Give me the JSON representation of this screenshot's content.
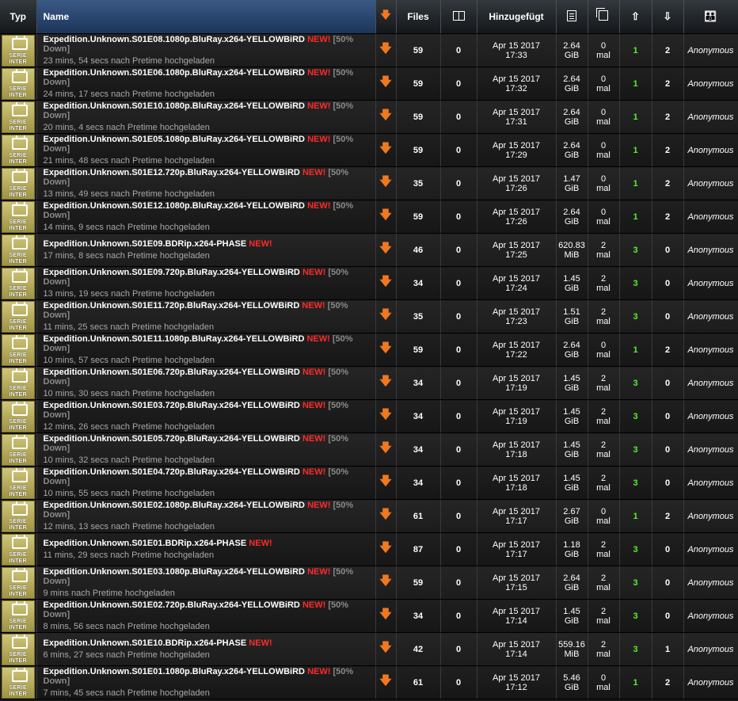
{
  "headers": {
    "typ": "Typ",
    "name": "Name",
    "files": "Files",
    "added": "Hinzugefügt",
    "icons": {
      "download": "download-arrow-icon",
      "description": "book-icon",
      "size": "document-icon",
      "snatched": "copy-icon",
      "seeders": "up-arrow-icon",
      "leechers": "down-arrow-icon",
      "uploader": "people-icon"
    }
  },
  "category_label": [
    "SERIE",
    "INTER"
  ],
  "colors": {
    "new": "#ff2a2a",
    "download": "#f07820",
    "seeders": "#55ee33",
    "header_name": "#2a4770"
  },
  "rows": [
    {
      "name": "Expedition.Unknown.S01E08.1080p.BluRay.x264-YELLOWBiRD",
      "new": "NEW!",
      "promo": "[50% Down]",
      "sub": "23 mins, 54 secs nach Pretime hochgeladen",
      "files": "59",
      "comments": "0",
      "date": "Apr 15 2017",
      "time": "17:33",
      "size": "2.64",
      "unit": "GiB",
      "snatched": "0",
      "snatched_unit": "mal",
      "seeders": "1",
      "leechers": "2",
      "uploader": "Anonymous"
    },
    {
      "name": "Expedition.Unknown.S01E06.1080p.BluRay.x264-YELLOWBiRD",
      "new": "NEW!",
      "promo": "[50% Down]",
      "sub": "24 mins, 17 secs nach Pretime hochgeladen",
      "files": "59",
      "comments": "0",
      "date": "Apr 15 2017",
      "time": "17:32",
      "size": "2.64",
      "unit": "GiB",
      "snatched": "0",
      "snatched_unit": "mal",
      "seeders": "1",
      "leechers": "2",
      "uploader": "Anonymous"
    },
    {
      "name": "Expedition.Unknown.S01E10.1080p.BluRay.x264-YELLOWBiRD",
      "new": "NEW!",
      "promo": "[50% Down]",
      "sub": "20 mins, 4 secs nach Pretime hochgeladen",
      "files": "59",
      "comments": "0",
      "date": "Apr 15 2017",
      "time": "17:31",
      "size": "2.64",
      "unit": "GiB",
      "snatched": "0",
      "snatched_unit": "mal",
      "seeders": "1",
      "leechers": "2",
      "uploader": "Anonymous"
    },
    {
      "name": "Expedition.Unknown.S01E05.1080p.BluRay.x264-YELLOWBiRD",
      "new": "NEW!",
      "promo": "[50% Down]",
      "sub": "21 mins, 48 secs nach Pretime hochgeladen",
      "files": "59",
      "comments": "0",
      "date": "Apr 15 2017",
      "time": "17:29",
      "size": "2.64",
      "unit": "GiB",
      "snatched": "0",
      "snatched_unit": "mal",
      "seeders": "1",
      "leechers": "2",
      "uploader": "Anonymous"
    },
    {
      "name": "Expedition.Unknown.S01E12.720p.BluRay.x264-YELLOWBiRD",
      "new": "NEW!",
      "promo": "[50% Down]",
      "sub": "13 mins, 49 secs nach Pretime hochgeladen",
      "files": "35",
      "comments": "0",
      "date": "Apr 15 2017",
      "time": "17:26",
      "size": "1.47",
      "unit": "GiB",
      "snatched": "0",
      "snatched_unit": "mal",
      "seeders": "1",
      "leechers": "2",
      "uploader": "Anonymous"
    },
    {
      "name": "Expedition.Unknown.S01E12.1080p.BluRay.x264-YELLOWBiRD",
      "new": "NEW!",
      "promo": "[50% Down]",
      "sub": "14 mins, 9 secs nach Pretime hochgeladen",
      "files": "59",
      "comments": "0",
      "date": "Apr 15 2017",
      "time": "17:26",
      "size": "2.64",
      "unit": "GiB",
      "snatched": "0",
      "snatched_unit": "mal",
      "seeders": "1",
      "leechers": "2",
      "uploader": "Anonymous"
    },
    {
      "name": "Expedition.Unknown.S01E09.BDRip.x264-PHASE",
      "new": "NEW!",
      "promo": "",
      "sub": "17 mins, 8 secs nach Pretime hochgeladen",
      "files": "46",
      "comments": "0",
      "date": "Apr 15 2017",
      "time": "17:25",
      "size": "620.83",
      "unit": "MiB",
      "snatched": "2",
      "snatched_unit": "mal",
      "seeders": "3",
      "leechers": "0",
      "uploader": "Anonymous"
    },
    {
      "name": "Expedition.Unknown.S01E09.720p.BluRay.x264-YELLOWBiRD",
      "new": "NEW!",
      "promo": "[50% Down]",
      "sub": "13 mins, 19 secs nach Pretime hochgeladen",
      "files": "34",
      "comments": "0",
      "date": "Apr 15 2017",
      "time": "17:24",
      "size": "1.45",
      "unit": "GiB",
      "snatched": "2",
      "snatched_unit": "mal",
      "seeders": "3",
      "leechers": "0",
      "uploader": "Anonymous"
    },
    {
      "name": "Expedition.Unknown.S01E11.720p.BluRay.x264-YELLOWBiRD",
      "new": "NEW!",
      "promo": "[50% Down]",
      "sub": "11 mins, 25 secs nach Pretime hochgeladen",
      "files": "35",
      "comments": "0",
      "date": "Apr 15 2017",
      "time": "17:23",
      "size": "1.51",
      "unit": "GiB",
      "snatched": "2",
      "snatched_unit": "mal",
      "seeders": "3",
      "leechers": "0",
      "uploader": "Anonymous"
    },
    {
      "name": "Expedition.Unknown.S01E11.1080p.BluRay.x264-YELLOWBiRD",
      "new": "NEW!",
      "promo": "[50% Down]",
      "sub": "10 mins, 57 secs nach Pretime hochgeladen",
      "files": "59",
      "comments": "0",
      "date": "Apr 15 2017",
      "time": "17:22",
      "size": "2.64",
      "unit": "GiB",
      "snatched": "0",
      "snatched_unit": "mal",
      "seeders": "1",
      "leechers": "2",
      "uploader": "Anonymous"
    },
    {
      "name": "Expedition.Unknown.S01E06.720p.BluRay.x264-YELLOWBiRD",
      "new": "NEW!",
      "promo": "[50% Down]",
      "sub": "10 mins, 30 secs nach Pretime hochgeladen",
      "files": "34",
      "comments": "0",
      "date": "Apr 15 2017",
      "time": "17:19",
      "size": "1.45",
      "unit": "GiB",
      "snatched": "2",
      "snatched_unit": "mal",
      "seeders": "3",
      "leechers": "0",
      "uploader": "Anonymous"
    },
    {
      "name": "Expedition.Unknown.S01E03.720p.BluRay.x264-YELLOWBiRD",
      "new": "NEW!",
      "promo": "[50% Down]",
      "sub": "12 mins, 26 secs nach Pretime hochgeladen",
      "files": "34",
      "comments": "0",
      "date": "Apr 15 2017",
      "time": "17:19",
      "size": "1.45",
      "unit": "GiB",
      "snatched": "2",
      "snatched_unit": "mal",
      "seeders": "3",
      "leechers": "0",
      "uploader": "Anonymous"
    },
    {
      "name": "Expedition.Unknown.S01E05.720p.BluRay.x264-YELLOWBiRD",
      "new": "NEW!",
      "promo": "[50% Down]",
      "sub": "10 mins, 32 secs nach Pretime hochgeladen",
      "files": "34",
      "comments": "0",
      "date": "Apr 15 2017",
      "time": "17:18",
      "size": "1.45",
      "unit": "GiB",
      "snatched": "2",
      "snatched_unit": "mal",
      "seeders": "3",
      "leechers": "0",
      "uploader": "Anonymous"
    },
    {
      "name": "Expedition.Unknown.S01E04.720p.BluRay.x264-YELLOWBiRD",
      "new": "NEW!",
      "promo": "[50% Down]",
      "sub": "10 mins, 55 secs nach Pretime hochgeladen",
      "files": "34",
      "comments": "0",
      "date": "Apr 15 2017",
      "time": "17:18",
      "size": "1.45",
      "unit": "GiB",
      "snatched": "2",
      "snatched_unit": "mal",
      "seeders": "3",
      "leechers": "0",
      "uploader": "Anonymous"
    },
    {
      "name": "Expedition.Unknown.S01E02.1080p.BluRay.x264-YELLOWBiRD",
      "new": "NEW!",
      "promo": "[50% Down]",
      "sub": "12 mins, 13 secs nach Pretime hochgeladen",
      "files": "61",
      "comments": "0",
      "date": "Apr 15 2017",
      "time": "17:17",
      "size": "2.67",
      "unit": "GiB",
      "snatched": "0",
      "snatched_unit": "mal",
      "seeders": "1",
      "leechers": "2",
      "uploader": "Anonymous"
    },
    {
      "name": "Expedition.Unknown.S01E01.BDRip.x264-PHASE",
      "new": "NEW!",
      "promo": "",
      "sub": "11 mins, 29 secs nach Pretime hochgeladen",
      "files": "87",
      "comments": "0",
      "date": "Apr 15 2017",
      "time": "17:17",
      "size": "1.18",
      "unit": "GiB",
      "snatched": "2",
      "snatched_unit": "mal",
      "seeders": "3",
      "leechers": "0",
      "uploader": "Anonymous"
    },
    {
      "name": "Expedition.Unknown.S01E03.1080p.BluRay.x264-YELLOWBiRD",
      "new": "NEW!",
      "promo": "[50% Down]",
      "sub": "9 mins nach Pretime hochgeladen",
      "files": "59",
      "comments": "0",
      "date": "Apr 15 2017",
      "time": "17:15",
      "size": "2.64",
      "unit": "GiB",
      "snatched": "2",
      "snatched_unit": "mal",
      "seeders": "3",
      "leechers": "0",
      "uploader": "Anonymous"
    },
    {
      "name": "Expedition.Unknown.S01E02.720p.BluRay.x264-YELLOWBiRD",
      "new": "NEW!",
      "promo": "[50% Down]",
      "sub": "8 mins, 56 secs nach Pretime hochgeladen",
      "files": "34",
      "comments": "0",
      "date": "Apr 15 2017",
      "time": "17:14",
      "size": "1.45",
      "unit": "GiB",
      "snatched": "2",
      "snatched_unit": "mal",
      "seeders": "3",
      "leechers": "0",
      "uploader": "Anonymous"
    },
    {
      "name": "Expedition.Unknown.S01E10.BDRip.x264-PHASE",
      "new": "NEW!",
      "promo": "",
      "sub": "6 mins, 27 secs nach Pretime hochgeladen",
      "files": "42",
      "comments": "0",
      "date": "Apr 15 2017",
      "time": "17:14",
      "size": "559.16",
      "unit": "MiB",
      "snatched": "2",
      "snatched_unit": "mal",
      "seeders": "3",
      "leechers": "1",
      "uploader": "Anonymous"
    },
    {
      "name": "Expedition.Unknown.S01E01.1080p.BluRay.x264-YELLOWBiRD",
      "new": "NEW!",
      "promo": "[50% Down]",
      "sub": "7 mins, 45 secs nach Pretime hochgeladen",
      "files": "61",
      "comments": "0",
      "date": "Apr 15 2017",
      "time": "17:12",
      "size": "5.46",
      "unit": "GiB",
      "snatched": "0",
      "snatched_unit": "mal",
      "seeders": "1",
      "leechers": "2",
      "uploader": "Anonymous"
    }
  ]
}
